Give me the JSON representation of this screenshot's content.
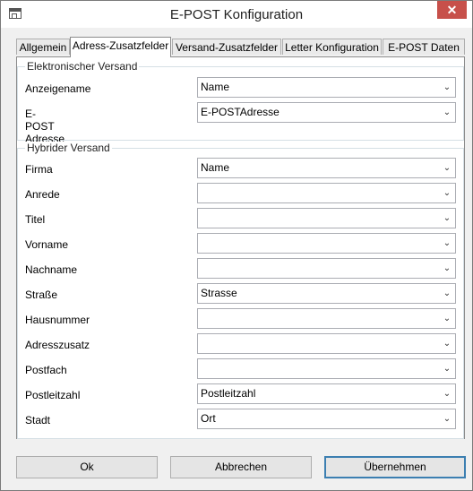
{
  "window": {
    "title": "E-POST Konfiguration",
    "close_glyph": "✕"
  },
  "tabs": [
    {
      "label": "Allgemein"
    },
    {
      "label": "Adress-Zusatzfelder"
    },
    {
      "label": "Versand-Zusatzfelder"
    },
    {
      "label": "Letter Konfiguration"
    },
    {
      "label": "E-POST Daten"
    }
  ],
  "active_tab": "Adress-Zusatzfelder",
  "electronic": {
    "title": "Elektronischer Versand",
    "fields": [
      {
        "label": "Anzeigename",
        "value": "Name"
      },
      {
        "label": "E-POST Adresse",
        "value": "E-POSTAdresse"
      }
    ]
  },
  "hybrid": {
    "title": "Hybrider Versand",
    "fields": [
      {
        "label": "Firma",
        "value": "Name"
      },
      {
        "label": "Anrede",
        "value": ""
      },
      {
        "label": "Titel",
        "value": ""
      },
      {
        "label": "Vorname",
        "value": ""
      },
      {
        "label": "Nachname",
        "value": ""
      },
      {
        "label": "Straße",
        "value": "Strasse"
      },
      {
        "label": "Hausnummer",
        "value": ""
      },
      {
        "label": "Adresszusatz",
        "value": ""
      },
      {
        "label": "Postfach",
        "value": ""
      },
      {
        "label": "Postleitzahl",
        "value": "Postleitzahl"
      },
      {
        "label": "Stadt",
        "value": "Ort"
      }
    ]
  },
  "buttons": {
    "ok": "Ok",
    "cancel": "Abbrechen",
    "apply": "Übernehmen"
  },
  "icons": {
    "dropdown": "chevron-down-icon",
    "arrow_glyph": "⌄"
  }
}
